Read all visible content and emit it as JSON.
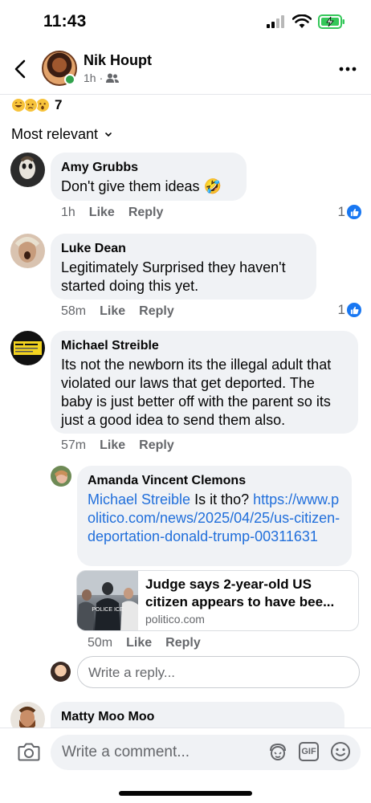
{
  "status_bar": {
    "time": "11:43"
  },
  "header": {
    "name": "Nik Houpt",
    "time": "1h",
    "audience_icon": "friends-icon"
  },
  "reactions": {
    "count": "7",
    "types": [
      "laugh-emoji",
      "sad-emoji",
      "wow-emoji"
    ]
  },
  "sort": {
    "label": "Most relevant"
  },
  "comments": [
    {
      "name": "Amy Grubbs",
      "text": "Don't give them ideas 🤣",
      "time": "1h",
      "like": "Like",
      "reply": "Reply",
      "likes": "1"
    },
    {
      "name": "Luke Dean",
      "text": "Legitimately Surprised they haven't started doing this yet.",
      "time": "58m",
      "like": "Like",
      "reply": "Reply",
      "likes": "1"
    },
    {
      "name": "Michael Streible",
      "text": "Its not the newborn its the illegal adult that violated our laws that get deported. The baby is just better off with the parent so its just a good idea to send them also.",
      "time": "57m",
      "like": "Like",
      "reply": "Reply"
    },
    {
      "name": "Matty Moo Moo"
    }
  ],
  "reply": {
    "name": "Amanda Vincent Clemons",
    "mention": "Michael Streible",
    "text": " Is it tho? ",
    "link": "https://www.politico.com/news/2025/04/25/us-citizen-deportation-donald-trump-00311631",
    "time": "50m",
    "like": "Like",
    "reply": "Reply",
    "preview": {
      "title_line1": "Judge says 2-year-old US",
      "title_line2": "citizen appears to have bee...",
      "domain": "politico.com",
      "thumb_text": "POLICE ICE"
    }
  },
  "reply_input": {
    "placeholder": "Write a reply..."
  },
  "composer": {
    "placeholder": "Write a comment...",
    "gif_label": "GIF"
  }
}
